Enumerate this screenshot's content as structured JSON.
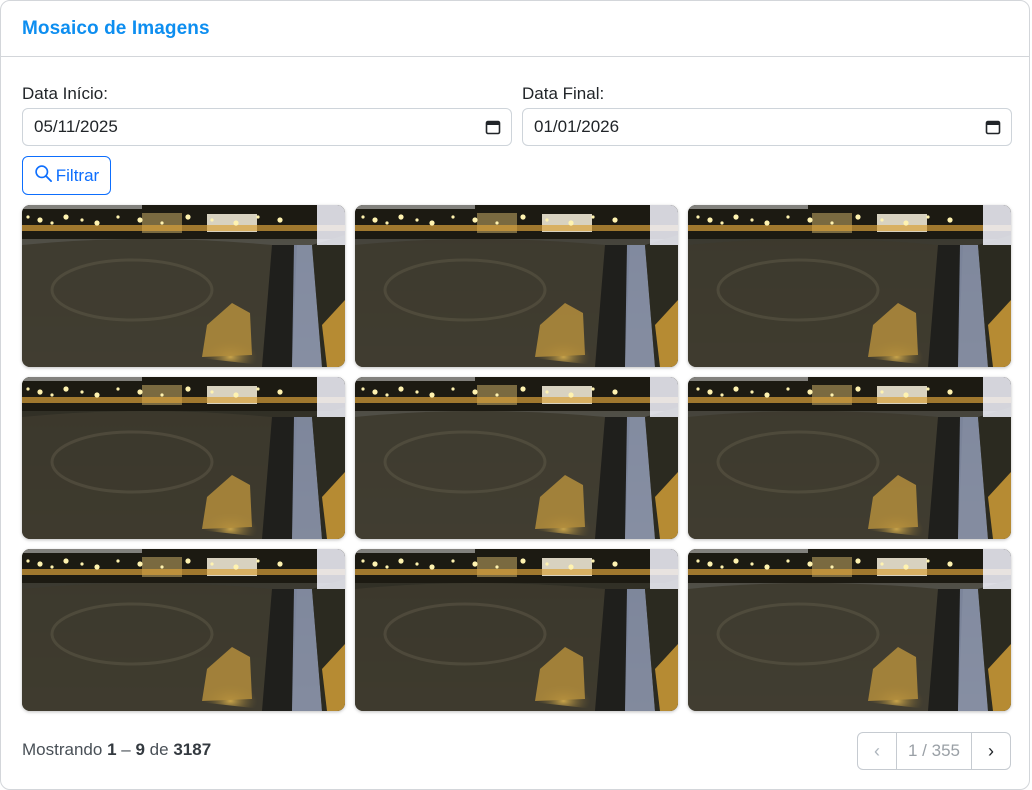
{
  "header": {
    "title": "Mosaico de Imagens"
  },
  "filters": {
    "start": {
      "label": "Data Início:",
      "value": "05/11/2025",
      "icon": "calendar-icon"
    },
    "end": {
      "label": "Data Final:",
      "value": "01/01/2026",
      "icon": "calendar-icon"
    },
    "filter_button": {
      "label": "Filtrar",
      "icon": "search-icon"
    }
  },
  "gallery": {
    "images": [
      {
        "alt": "night camera frame 1"
      },
      {
        "alt": "night camera frame 2"
      },
      {
        "alt": "night camera frame 3"
      },
      {
        "alt": "night camera frame 4"
      },
      {
        "alt": "night camera frame 5"
      },
      {
        "alt": "night camera frame 6"
      },
      {
        "alt": "night camera frame 7"
      },
      {
        "alt": "night camera frame 8"
      },
      {
        "alt": "night camera frame 9"
      }
    ]
  },
  "footer": {
    "prefix": "Mostrando",
    "from": "1",
    "dash": "–",
    "to": "9",
    "of": "de",
    "total": "3187",
    "pager": {
      "prev": "‹",
      "info": "1 / 355",
      "next": "›"
    }
  },
  "colors": {
    "title": "#0d8ef0",
    "primary": "#0d6efd",
    "border": "#d3d6da"
  }
}
